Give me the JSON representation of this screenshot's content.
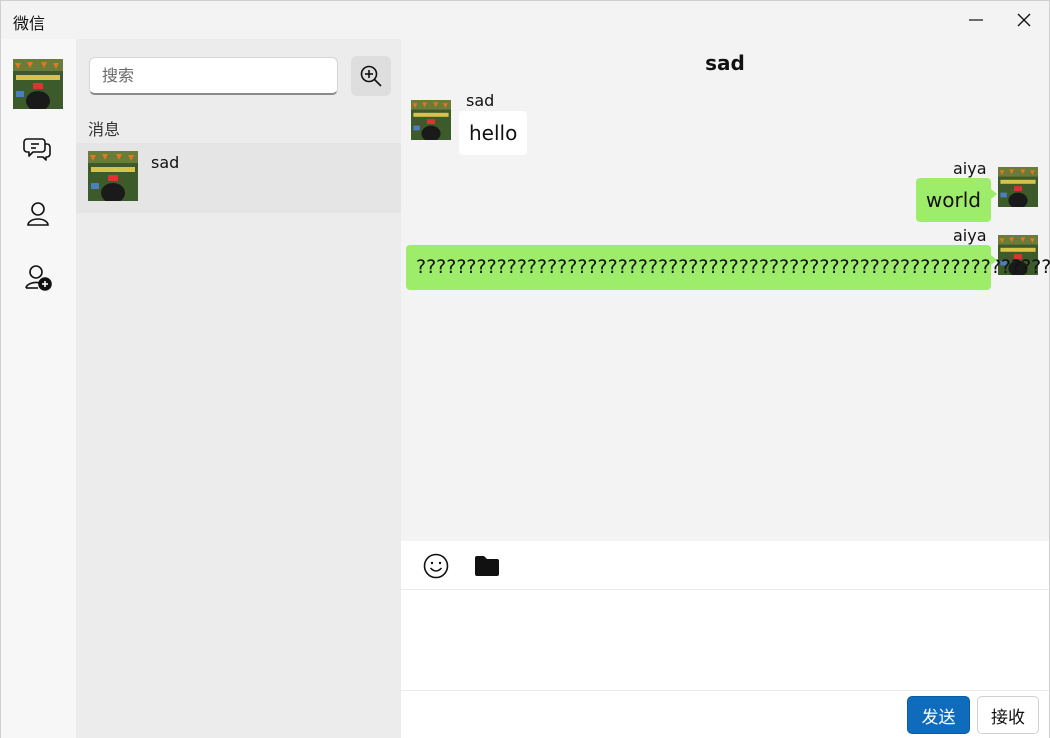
{
  "window": {
    "title": "微信"
  },
  "search": {
    "placeholder": "搜索"
  },
  "list": {
    "section_label": "消息",
    "contacts": [
      {
        "name": "sad"
      }
    ]
  },
  "chat": {
    "title": "sad",
    "messages": [
      {
        "sender": "sad",
        "text": "hello",
        "direction": "incoming"
      },
      {
        "sender": "aiya",
        "text": "world",
        "direction": "outgoing"
      },
      {
        "sender": "aiya",
        "text": "?????????????????????????????????????????????????????????????????",
        "direction": "outgoing"
      }
    ]
  },
  "input": {
    "send_label": "发送",
    "receive_label": "接收"
  },
  "colors": {
    "outgoing_bubble": "#9ded6b",
    "incoming_bubble": "#ffffff",
    "send_button": "#0f6cbd"
  },
  "icons": {
    "nav": [
      "chat-bubbles-icon",
      "user-icon",
      "add-user-icon"
    ],
    "toolbar": [
      "emoji-icon",
      "folder-icon"
    ],
    "search_button": "zoom-in-icon"
  }
}
